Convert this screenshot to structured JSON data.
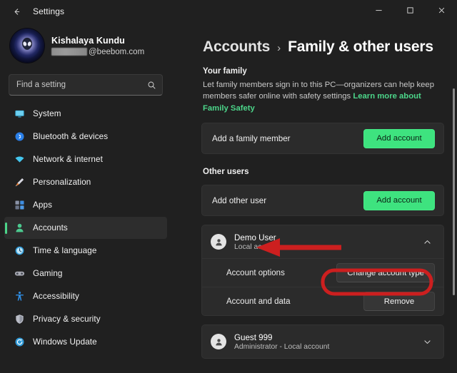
{
  "window": {
    "title": "Settings",
    "back_icon": "back-arrow-icon",
    "controls": {
      "minimize": "minimize-icon",
      "maximize": "maximize-icon",
      "close": "close-icon"
    }
  },
  "sidebar": {
    "account": {
      "avatar_icon": "alien-avatar-image",
      "name": "Kishalaya Kundu",
      "email_redacted": true,
      "email_domain": "@beebom.com"
    },
    "search": {
      "placeholder": "Find a setting",
      "value": "",
      "icon": "search-icon"
    },
    "items": [
      {
        "label": "System",
        "icon": "monitor-icon",
        "selected": false
      },
      {
        "label": "Bluetooth & devices",
        "icon": "bluetooth-icon",
        "selected": false
      },
      {
        "label": "Network & internet",
        "icon": "wifi-icon",
        "selected": false
      },
      {
        "label": "Personalization",
        "icon": "paintbrush-icon",
        "selected": false
      },
      {
        "label": "Apps",
        "icon": "apps-grid-icon",
        "selected": false
      },
      {
        "label": "Accounts",
        "icon": "person-icon",
        "selected": true
      },
      {
        "label": "Time & language",
        "icon": "clock-icon",
        "selected": false
      },
      {
        "label": "Gaming",
        "icon": "gamepad-icon",
        "selected": false
      },
      {
        "label": "Accessibility",
        "icon": "accessibility-icon",
        "selected": false
      },
      {
        "label": "Privacy & security",
        "icon": "shield-icon",
        "selected": false
      },
      {
        "label": "Windows Update",
        "icon": "update-icon",
        "selected": false
      }
    ]
  },
  "content": {
    "breadcrumb": {
      "parent": "Accounts",
      "separator": "›",
      "current": "Family & other users"
    },
    "your_family": {
      "heading": "Your family",
      "description": "Let family members sign in to this PC—organizers can help keep members safer online with safety settings",
      "link_text": "Learn more about Family Safety",
      "link_color": "#4cd68a",
      "row": {
        "label": "Add a family member",
        "button": "Add account"
      }
    },
    "other_users": {
      "heading": "Other users",
      "add_row": {
        "label": "Add other user",
        "button": "Add account"
      },
      "users": [
        {
          "name": "Demo User",
          "subtitle": "Local account",
          "expanded": true,
          "chevron": "chevron-up-icon",
          "options": [
            {
              "label": "Account options",
              "button": "Change account type",
              "highlighted": true
            },
            {
              "label": "Account and data",
              "button": "Remove",
              "highlighted": false
            }
          ]
        },
        {
          "name": "Guest 999",
          "subtitle": "Administrator - Local account",
          "expanded": false,
          "chevron": "chevron-down-icon",
          "options": []
        }
      ]
    }
  },
  "annotations": {
    "arrow_color": "#cc1f1f",
    "highlight_color": "#cc1f1f",
    "arrow_target": "Demo User",
    "highlight_target": "Change account type"
  }
}
